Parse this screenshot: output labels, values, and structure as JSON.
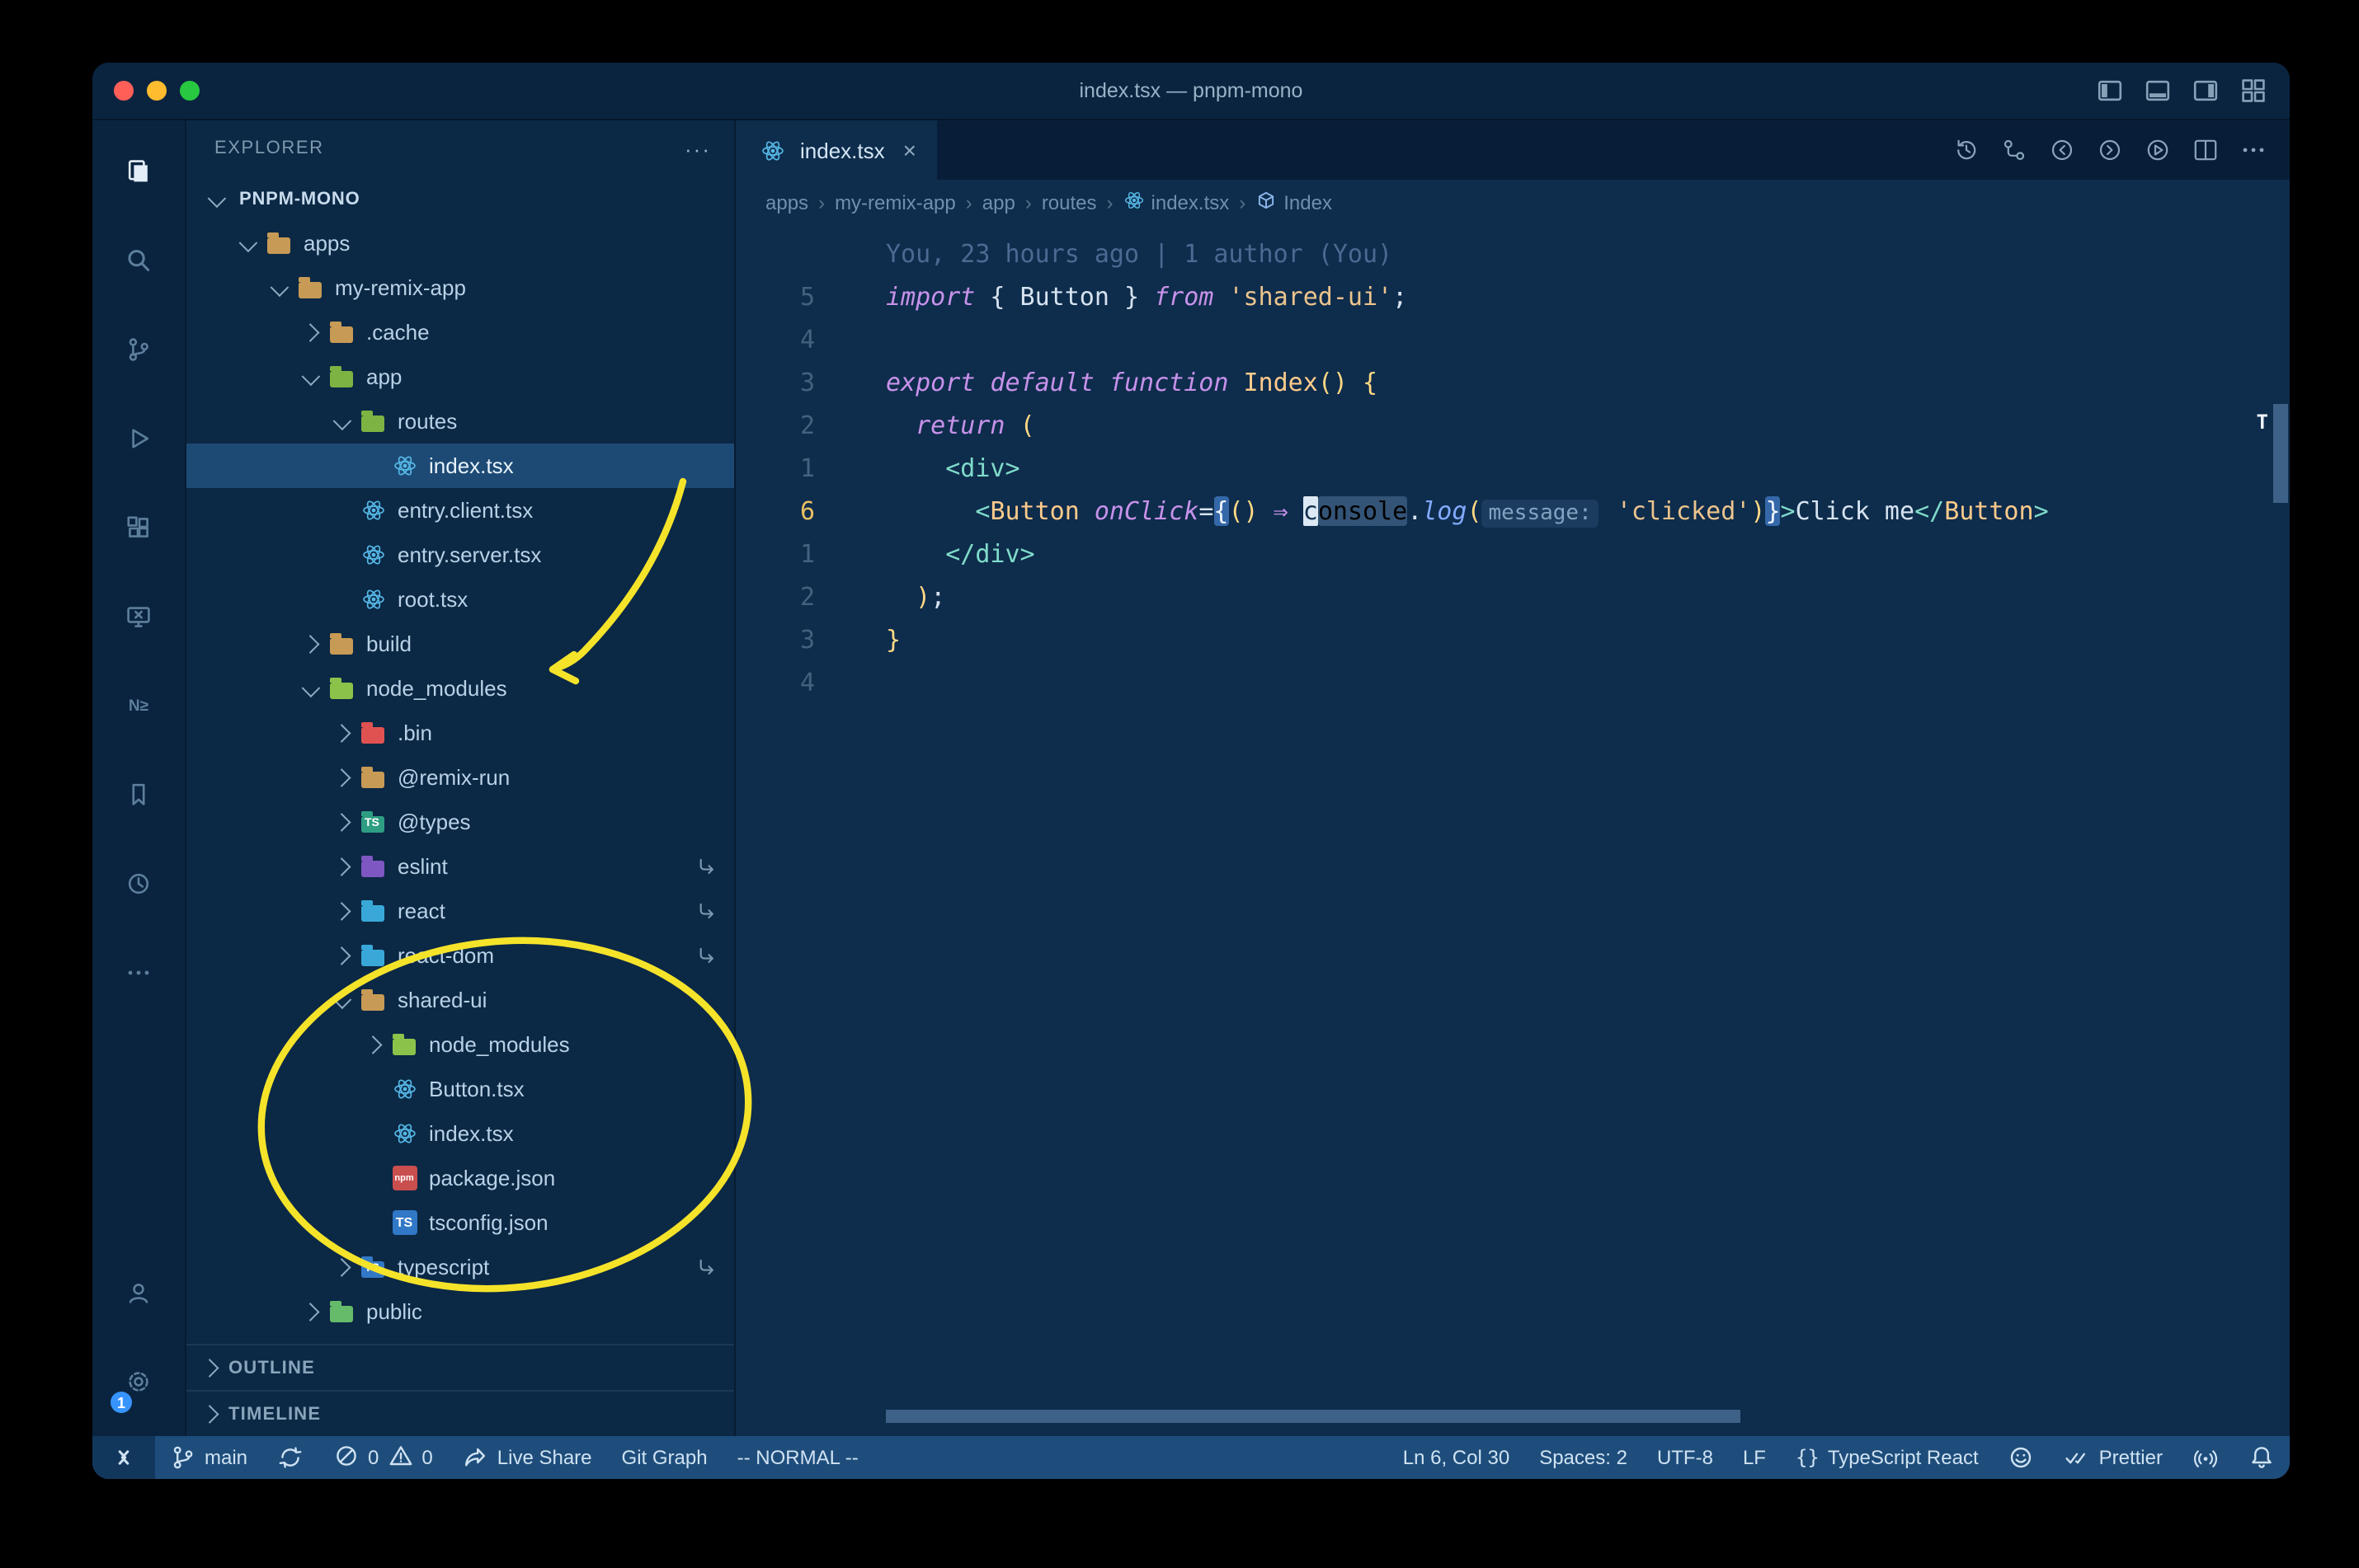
{
  "titlebar": {
    "title": "index.tsx — pnpm-mono",
    "window_controls": [
      "close",
      "minimize",
      "zoom"
    ],
    "layout_controls": [
      "toggle-sidebar",
      "toggle-panel",
      "toggle-secondary-sidebar",
      "customize-layout"
    ]
  },
  "activity_bar": {
    "top": [
      {
        "name": "explorer",
        "active": true
      },
      {
        "name": "search"
      },
      {
        "name": "source-control"
      },
      {
        "name": "run-debug"
      },
      {
        "name": "extensions"
      },
      {
        "name": "remote-explorer"
      },
      {
        "name": "nx-console"
      },
      {
        "name": "bookmarks"
      },
      {
        "name": "project-manager"
      },
      {
        "name": "more"
      }
    ],
    "bottom": [
      {
        "name": "accounts"
      },
      {
        "name": "settings",
        "badge": "1"
      }
    ]
  },
  "explorer": {
    "title": "EXPLORER",
    "actions": "···",
    "tree": [
      {
        "label": "PNPM-MONO",
        "level": 0,
        "root": true,
        "chevron": "down"
      },
      {
        "label": "apps",
        "level": 1,
        "chevron": "down",
        "icon": "folder",
        "color": "#c79a55"
      },
      {
        "label": "my-remix-app",
        "level": 2,
        "chevron": "down",
        "icon": "folder",
        "color": "#c79a55"
      },
      {
        "label": ".cache",
        "level": 3,
        "chevron": "right",
        "icon": "folder",
        "color": "#c79a55"
      },
      {
        "label": "app",
        "level": 3,
        "chevron": "down",
        "icon": "folder",
        "color": "#7cb342"
      },
      {
        "label": "routes",
        "level": 4,
        "chevron": "down",
        "icon": "folder",
        "color": "#7cb342"
      },
      {
        "label": "index.tsx",
        "level": 5,
        "icon": "react",
        "selected": true
      },
      {
        "label": "entry.client.tsx",
        "level": 4,
        "icon": "react"
      },
      {
        "label": "entry.server.tsx",
        "level": 4,
        "icon": "react"
      },
      {
        "label": "root.tsx",
        "level": 4,
        "icon": "react"
      },
      {
        "label": "build",
        "level": 3,
        "chevron": "right",
        "icon": "folder",
        "color": "#c79a55"
      },
      {
        "label": "node_modules",
        "level": 3,
        "chevron": "down",
        "icon": "folder",
        "color": "#8bc34a"
      },
      {
        "label": ".bin",
        "level": 4,
        "chevron": "right",
        "icon": "folder",
        "color": "#e05252"
      },
      {
        "label": "@remix-run",
        "level": 4,
        "chevron": "right",
        "icon": "folder",
        "color": "#c79a55"
      },
      {
        "label": "@types",
        "level": 4,
        "chevron": "right",
        "icon": "folder-ts",
        "color": "#2e9e83"
      },
      {
        "label": "eslint",
        "level": 4,
        "chevron": "right",
        "icon": "folder",
        "color": "#7e57c2",
        "symlink": true
      },
      {
        "label": "react",
        "level": 4,
        "chevron": "right",
        "icon": "folder",
        "color": "#39a8d8",
        "symlink": true
      },
      {
        "label": "react-dom",
        "level": 4,
        "chevron": "right",
        "icon": "folder",
        "color": "#39a8d8",
        "symlink": true
      },
      {
        "label": "shared-ui",
        "level": 4,
        "chevron": "down",
        "icon": "folder",
        "color": "#c79a55"
      },
      {
        "label": "node_modules",
        "level": 5,
        "chevron": "right",
        "icon": "folder",
        "color": "#8bc34a"
      },
      {
        "label": "Button.tsx",
        "level": 5,
        "icon": "react"
      },
      {
        "label": "index.tsx",
        "level": 5,
        "icon": "react"
      },
      {
        "label": "package.json",
        "level": 5,
        "icon": "npm"
      },
      {
        "label": "tsconfig.json",
        "level": 5,
        "icon": "ts"
      },
      {
        "label": "typescript",
        "level": 4,
        "chevron": "right",
        "icon": "folder-ts",
        "color": "#3178c6",
        "symlink": true
      },
      {
        "label": "public",
        "level": 3,
        "chevron": "right",
        "icon": "folder",
        "color": "#66bb6a"
      }
    ],
    "sections": [
      {
        "label": "OUTLINE"
      },
      {
        "label": "TIMELINE"
      }
    ]
  },
  "editor": {
    "tab": {
      "label": "index.tsx",
      "close": "×"
    },
    "actions": [
      "history",
      "compare-changes",
      "nav-back",
      "nav-forward",
      "run",
      "split-editor",
      "more-actions"
    ],
    "breadcrumbs": {
      "separator": "›",
      "items": [
        {
          "label": "apps"
        },
        {
          "label": "my-remix-app"
        },
        {
          "label": "app"
        },
        {
          "label": "routes"
        },
        {
          "label": "index.tsx",
          "icon": "react-sm"
        },
        {
          "label": "Index",
          "icon": "symbol-module"
        }
      ]
    },
    "blame": "You, 23 hours ago | 1 author (You)",
    "overview_marker": "T",
    "lines": [
      {
        "n": "5",
        "t": [
          [
            "kw",
            "import"
          ],
          [
            "pn",
            " { Button } "
          ],
          [
            "kw",
            "from"
          ],
          [
            "pn",
            " "
          ],
          [
            "st",
            "'shared-ui'"
          ],
          [
            "pn",
            ";"
          ]
        ]
      },
      {
        "n": "4",
        "t": []
      },
      {
        "n": "3",
        "t": [
          [
            "kw",
            "export"
          ],
          [
            "pn",
            " "
          ],
          [
            "kw",
            "default"
          ],
          [
            "pn",
            " "
          ],
          [
            "kw",
            "function"
          ],
          [
            "pn",
            " "
          ],
          [
            "cmp",
            "Index"
          ],
          [
            "br",
            "()"
          ],
          [
            "pn",
            " "
          ],
          [
            "br",
            "{"
          ]
        ]
      },
      {
        "n": "2",
        "t": [
          [
            "pn",
            "  "
          ],
          [
            "kw",
            "return"
          ],
          [
            "pn",
            " "
          ],
          [
            "br",
            "("
          ]
        ]
      },
      {
        "n": "1",
        "t": [
          [
            "pn",
            "    "
          ],
          [
            "tag",
            "<div>"
          ]
        ]
      },
      {
        "n": "6",
        "current": true,
        "t": [
          [
            "pn",
            "      "
          ],
          [
            "tag",
            "<"
          ],
          [
            "cmp",
            "Button"
          ],
          [
            "pn",
            " "
          ],
          [
            "kw",
            "onClick"
          ],
          [
            "pn",
            "="
          ],
          [
            "mb",
            "{"
          ],
          [
            "br",
            "()"
          ],
          [
            "pn",
            " "
          ],
          [
            "ar",
            "⇒"
          ],
          [
            "pn",
            " "
          ],
          [
            "cur",
            "c"
          ],
          [
            "hw",
            "onsole"
          ],
          [
            "pn",
            "."
          ],
          [
            "fn",
            "log"
          ],
          [
            "br",
            "("
          ],
          [
            "in",
            "message:"
          ],
          [
            "pn",
            " "
          ],
          [
            "st",
            "'clicked'"
          ],
          [
            "br",
            ")"
          ],
          [
            "mb",
            "}"
          ],
          [
            "tag",
            ">"
          ],
          [
            "pn",
            "Click me"
          ],
          [
            "tag",
            "</"
          ],
          [
            "cmp",
            "Button"
          ],
          [
            "tag",
            ">"
          ]
        ]
      },
      {
        "n": "1",
        "t": [
          [
            "pn",
            "    "
          ],
          [
            "tag",
            "</div>"
          ]
        ]
      },
      {
        "n": "2",
        "t": [
          [
            "pn",
            "  "
          ],
          [
            "br",
            ")"
          ],
          [
            "pn",
            ";"
          ]
        ]
      },
      {
        "n": "3",
        "t": [
          [
            "br",
            "}"
          ]
        ]
      },
      {
        "n": "4",
        "t": []
      }
    ]
  },
  "status_bar": {
    "problems": {
      "errors": "0",
      "warnings": "0"
    },
    "left": [
      {
        "name": "remote-indicator",
        "icon": "remote"
      },
      {
        "name": "git-branch",
        "icon": "branch",
        "label": "main"
      },
      {
        "name": "sync-changes",
        "icon": "sync"
      },
      {
        "name": "problems",
        "icon": "problems"
      },
      {
        "name": "live-share",
        "icon": "live-share",
        "label": "Live Share"
      },
      {
        "name": "git-graph",
        "label": "Git Graph"
      },
      {
        "name": "vim-mode",
        "label": "-- NORMAL --"
      }
    ],
    "right": [
      {
        "name": "cursor-position",
        "label": "Ln 6, Col 30"
      },
      {
        "name": "indentation",
        "label": "Spaces: 2"
      },
      {
        "name": "encoding",
        "label": "UTF-8"
      },
      {
        "name": "eol",
        "label": "LF"
      },
      {
        "name": "language-mode",
        "icon": "braces",
        "label": "TypeScript React"
      },
      {
        "name": "feedback",
        "icon": "smiley"
      },
      {
        "name": "prettier",
        "icon": "double-check",
        "label": "Prettier"
      },
      {
        "name": "broadcast",
        "icon": "broadcast"
      },
      {
        "name": "notifications",
        "icon": "bell"
      }
    ]
  },
  "annotations": {
    "color": "#f5e32a",
    "shapes": [
      "arrow-to-node-modules",
      "ellipse-around-shared-ui"
    ]
  }
}
